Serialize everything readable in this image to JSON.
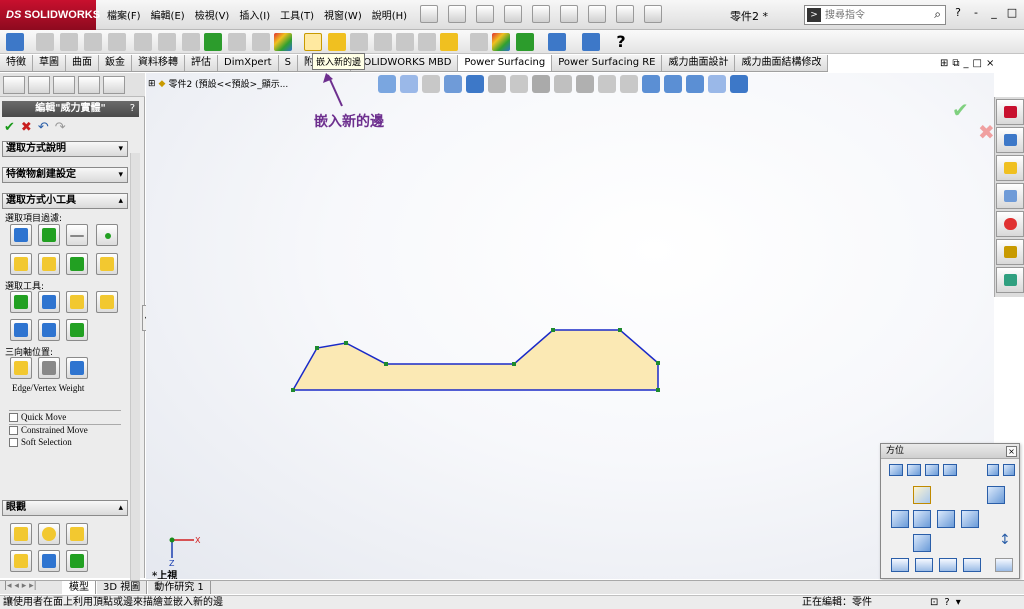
{
  "app": {
    "logo": "SOLIDWORKS",
    "logo_ds": "DS",
    "document_title": "零件2 *"
  },
  "menu": [
    "檔案(F)",
    "編輯(E)",
    "檢視(V)",
    "插入(I)",
    "工具(T)",
    "視窗(W)",
    "說明(H)"
  ],
  "search": {
    "placeholder": "搜尋指令",
    "prefix_icon": "command-prompt-icon"
  },
  "window_controls": [
    "?",
    "-",
    "_",
    "□",
    "×"
  ],
  "tooltip": "嵌入新的邊",
  "command_tabs": [
    {
      "label": "特徵",
      "active": false
    },
    {
      "label": "草圖",
      "active": false
    },
    {
      "label": "曲面",
      "active": false
    },
    {
      "label": "鈑金",
      "active": false
    },
    {
      "label": "資料移轉",
      "active": false
    },
    {
      "label": "評估",
      "active": false
    },
    {
      "label": "DimXpert",
      "active": false
    },
    {
      "label": "S",
      "active": false
    },
    {
      "label": "附加程式",
      "active": false
    },
    {
      "label": "SOLIDWORKS MBD",
      "active": false
    },
    {
      "label": "Power Surfacing",
      "active": true
    },
    {
      "label": "Power Surfacing RE",
      "active": false
    },
    {
      "label": "威力曲面設計",
      "active": false
    },
    {
      "label": "威力曲面結構修改",
      "active": false
    }
  ],
  "left_panel": {
    "title": "編輯\"威力實體\"",
    "help": "?",
    "sections": {
      "selection_help": "選取方式說明",
      "feature_settings": "特徵物創建設定",
      "selection_tools": "選取方式小工具",
      "appearance": "眼觀"
    },
    "labels": {
      "filter": "選取項目過濾:",
      "tools": "選取工具:",
      "triad": "三向軸位置:",
      "weight": "Edge/Vertex Weight"
    },
    "checkboxes": [
      "Quick Move",
      "Constrained Move",
      "Soft Selection"
    ]
  },
  "feature_tree": {
    "label": "零件2 (預設<<預設>_顯示..."
  },
  "annotation": "嵌入新的邊",
  "triad": {
    "x": "X",
    "y": "Y",
    "z": "Z",
    "label": "*上視"
  },
  "orientation_dialog": {
    "title": "方位",
    "close": "×"
  },
  "bottom_tabs": [
    {
      "label": "模型",
      "active": true
    },
    {
      "label": "3D 視圖",
      "active": false
    },
    {
      "label": "動作研究 1",
      "active": false
    }
  ],
  "status": {
    "left": "讓使用者在面上利用頂點或邊來描繪並嵌入新的邊",
    "right": "正在編輯：零件",
    "help": "?"
  },
  "colors": {
    "sketch_fill": "#fbe9b4",
    "sketch_edge": "#1a2ac8",
    "vertex": "#1f8a2f",
    "annotation": "#6d2f8e",
    "brand": "#c8102e"
  }
}
